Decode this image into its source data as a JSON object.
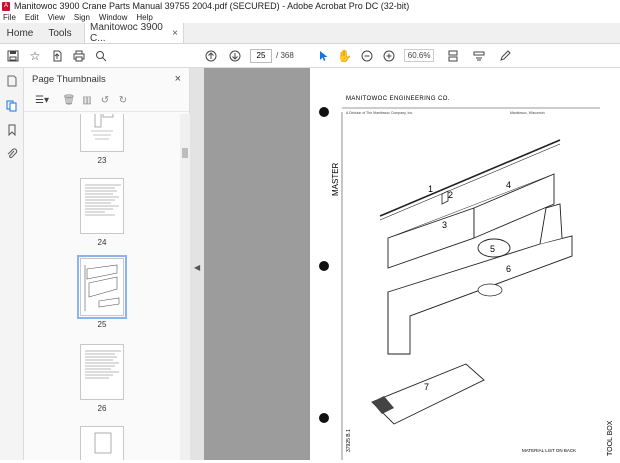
{
  "window": {
    "title": "Manitowoc 3900 Crane Parts Manual 39755 2004.pdf (SECURED) - Adobe Acrobat Pro DC (32-bit)"
  },
  "menu": [
    "File",
    "Edit",
    "View",
    "Sign",
    "Window",
    "Help"
  ],
  "tabs": {
    "home": "Home",
    "tools": "Tools",
    "document": "Manitowoc 3900 C...",
    "close": "×"
  },
  "toolbar": {
    "current_page": "25",
    "total_pages": "/ 368",
    "zoom": "60.6%"
  },
  "panel": {
    "title": "Page Thumbnails",
    "close": "×"
  },
  "thumbnails": [
    "23",
    "24",
    "25",
    "26"
  ],
  "document": {
    "company": "MANITOWOC ENGINEERING CO.",
    "subcompany": "A Division of The Manitowoc Company, Inc.",
    "location": "Manitowoc, Wisconsin",
    "side_label": "MASTER",
    "bottom_side_label": "TOOL BOX",
    "material_list": "MATERIAL LIST ON BACK",
    "drawing_number": "37925 B.1",
    "callouts": [
      "1",
      "2",
      "3",
      "4",
      "5",
      "6",
      "7"
    ]
  },
  "colors": {
    "acrobat_red": "#c8102e",
    "accent_blue": "#1473e6",
    "doc_background": "#9c9c9c"
  }
}
